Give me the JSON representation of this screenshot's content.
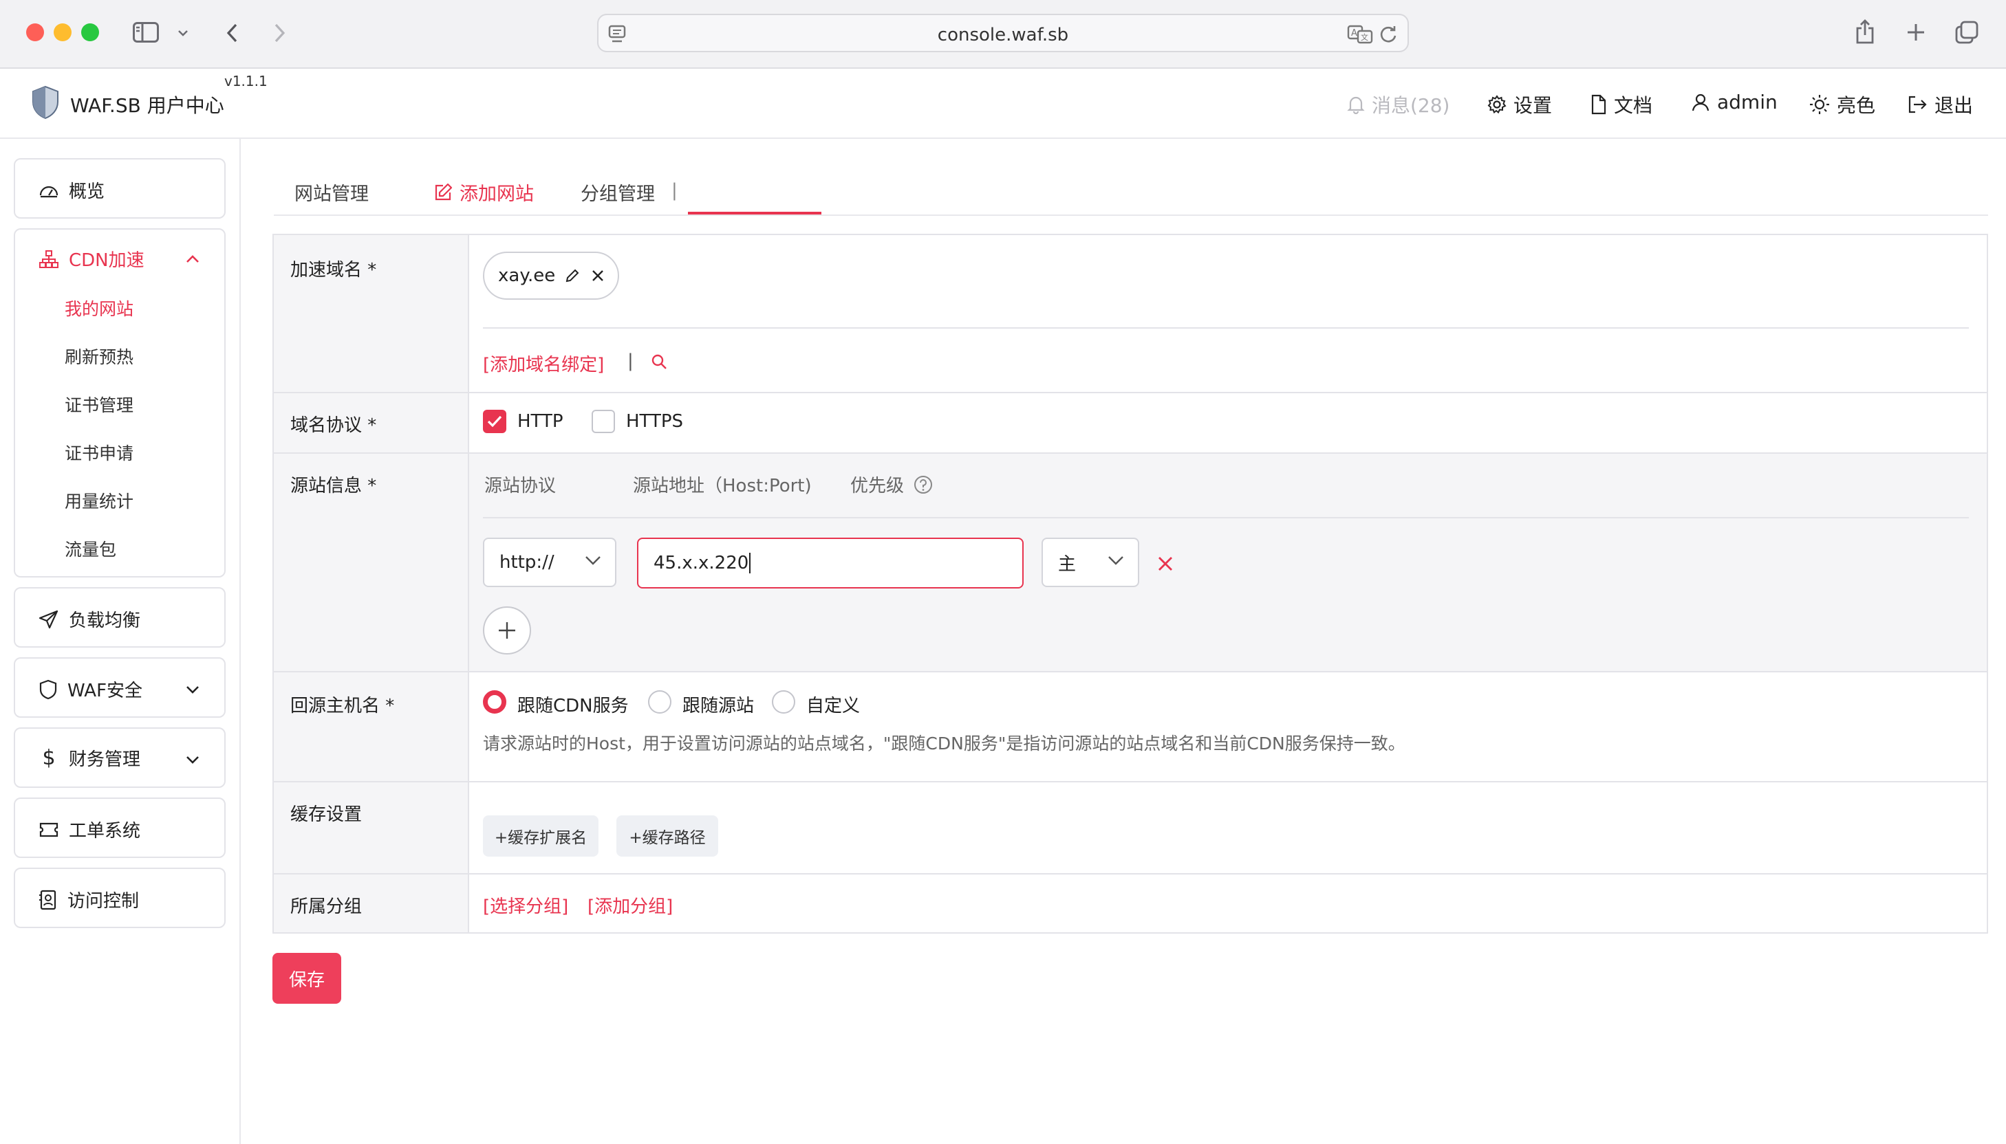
{
  "browser": {
    "url": "console.waf.sb"
  },
  "header": {
    "app_title": "WAF.SB 用户中心",
    "version": "v1.1.1",
    "nav": {
      "messages": "消息(28)",
      "settings": "设置",
      "docs": "文档",
      "user": "admin",
      "theme": "亮色",
      "logout": "退出"
    }
  },
  "sidebar": {
    "overview": "概览",
    "cdn": {
      "label": "CDN加速",
      "items": [
        "我的网站",
        "刷新预热",
        "证书管理",
        "证书申请",
        "用量统计",
        "流量包"
      ]
    },
    "load_balance": "负载均衡",
    "waf": "WAF安全",
    "finance": "财务管理",
    "tickets": "工单系统",
    "access": "访问控制"
  },
  "tabs": {
    "manage": "网站管理",
    "separator": "|",
    "add": "添加网站",
    "groups": "分组管理"
  },
  "form": {
    "domain": {
      "label": "加速域名 *",
      "chip_value": "xay.ee",
      "add_binding": "[添加域名绑定]",
      "separator": "|"
    },
    "protocol": {
      "label": "域名协议 *",
      "http": "HTTP",
      "https": "HTTPS",
      "http_checked": true,
      "https_checked": false
    },
    "origin": {
      "label": "源站信息 *",
      "col_protocol": "源站协议",
      "col_address": "源站地址（Host:Port)",
      "col_priority": "优先级",
      "protocol_value": "http://",
      "address_value": "45.x.x.220",
      "priority_value": "主"
    },
    "host": {
      "label": "回源主机名 *",
      "options": [
        "跟随CDN服务",
        "跟随源站",
        "自定义"
      ],
      "selected": "跟随CDN服务",
      "hint": "请求源站时的Host，用于设置访问源站的站点域名，\"跟随CDN服务\"是指访问源站的站点域名和当前CDN服务保持一致。"
    },
    "cache": {
      "label": "缓存设置",
      "add_ext": "+缓存扩展名",
      "add_path": "+缓存路径"
    },
    "group": {
      "label": "所属分组",
      "select": "[选择分组]",
      "add": "[添加分组]"
    }
  },
  "save_button": "保存",
  "colors": {
    "accent": "#e8344f",
    "save_bg": "#ee3f5b"
  }
}
